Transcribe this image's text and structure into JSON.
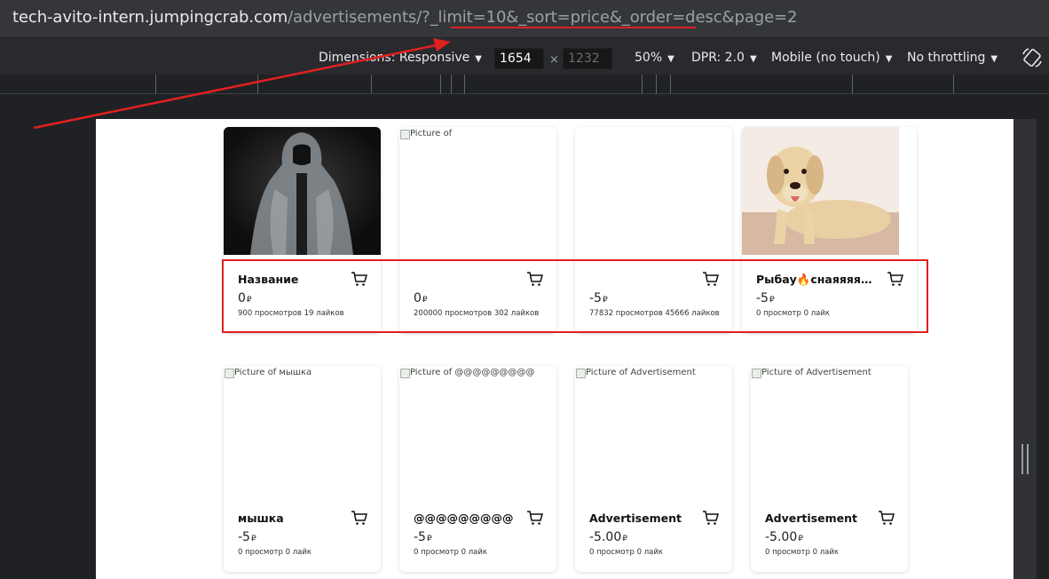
{
  "browser": {
    "url_host": "tech-avito-intern.jumpingcrab.com",
    "url_path": "/advertisements/?_limit=10&_sort=price&_order=desc&page=2"
  },
  "device_toolbar": {
    "dimensions": "Dimensions: Responsive",
    "width": "1654",
    "height": "1232",
    "times": "×",
    "zoom": "50%",
    "dpr": "DPR: 2.0",
    "device_type": "Mobile (no touch)",
    "throttling": "No throttling",
    "caret": "▼"
  },
  "cards": [
    {
      "alt": "",
      "title": "Название",
      "price": "0",
      "currency": "₽",
      "stats": "900 просмотров  19 лайков",
      "image": "hooded-figure"
    },
    {
      "alt": "Picture of",
      "title": "",
      "price": "0",
      "currency": "₽",
      "stats": "200000 просмотров  302 лайков",
      "image": "broken"
    },
    {
      "alt": "",
      "title": "",
      "price": "-5",
      "currency": "₽",
      "stats": "77832 просмотров  45666 лайков",
      "image": "blank"
    },
    {
      "alt": "",
      "title": "Рыбау🔥снаяяяяяяяяяяяяяя",
      "price": "-5",
      "currency": "₽",
      "stats": "0 просмотр  0 лайк",
      "image": "dog"
    },
    {
      "alt": "Picture of мышка",
      "title": "мышка",
      "price": "-5",
      "currency": "₽",
      "stats": "0 просмотр  0 лайк",
      "image": "broken"
    },
    {
      "alt": "Picture of @@@@@@@@@",
      "title": "@@@@@@@@@",
      "price": "-5",
      "currency": "₽",
      "stats": "0 просмотр  0 лайк",
      "image": "broken"
    },
    {
      "alt": "Picture of Advertisement",
      "title": "Advertisement",
      "price": "-5.00",
      "currency": "₽",
      "stats": "0 просмотр  0 лайк",
      "image": "broken"
    },
    {
      "alt": "Picture of Advertisement",
      "title": "Advertisement",
      "price": "-5.00",
      "currency": "₽",
      "stats": "0 просмотр  0 лайк",
      "image": "broken"
    }
  ],
  "colors": {
    "annotation": "#e02020",
    "page_bg": "#ffffff",
    "devtools_bg": "#202124"
  },
  "icons": [
    "cart-icon",
    "rotate-icon",
    "broken-image-icon"
  ]
}
